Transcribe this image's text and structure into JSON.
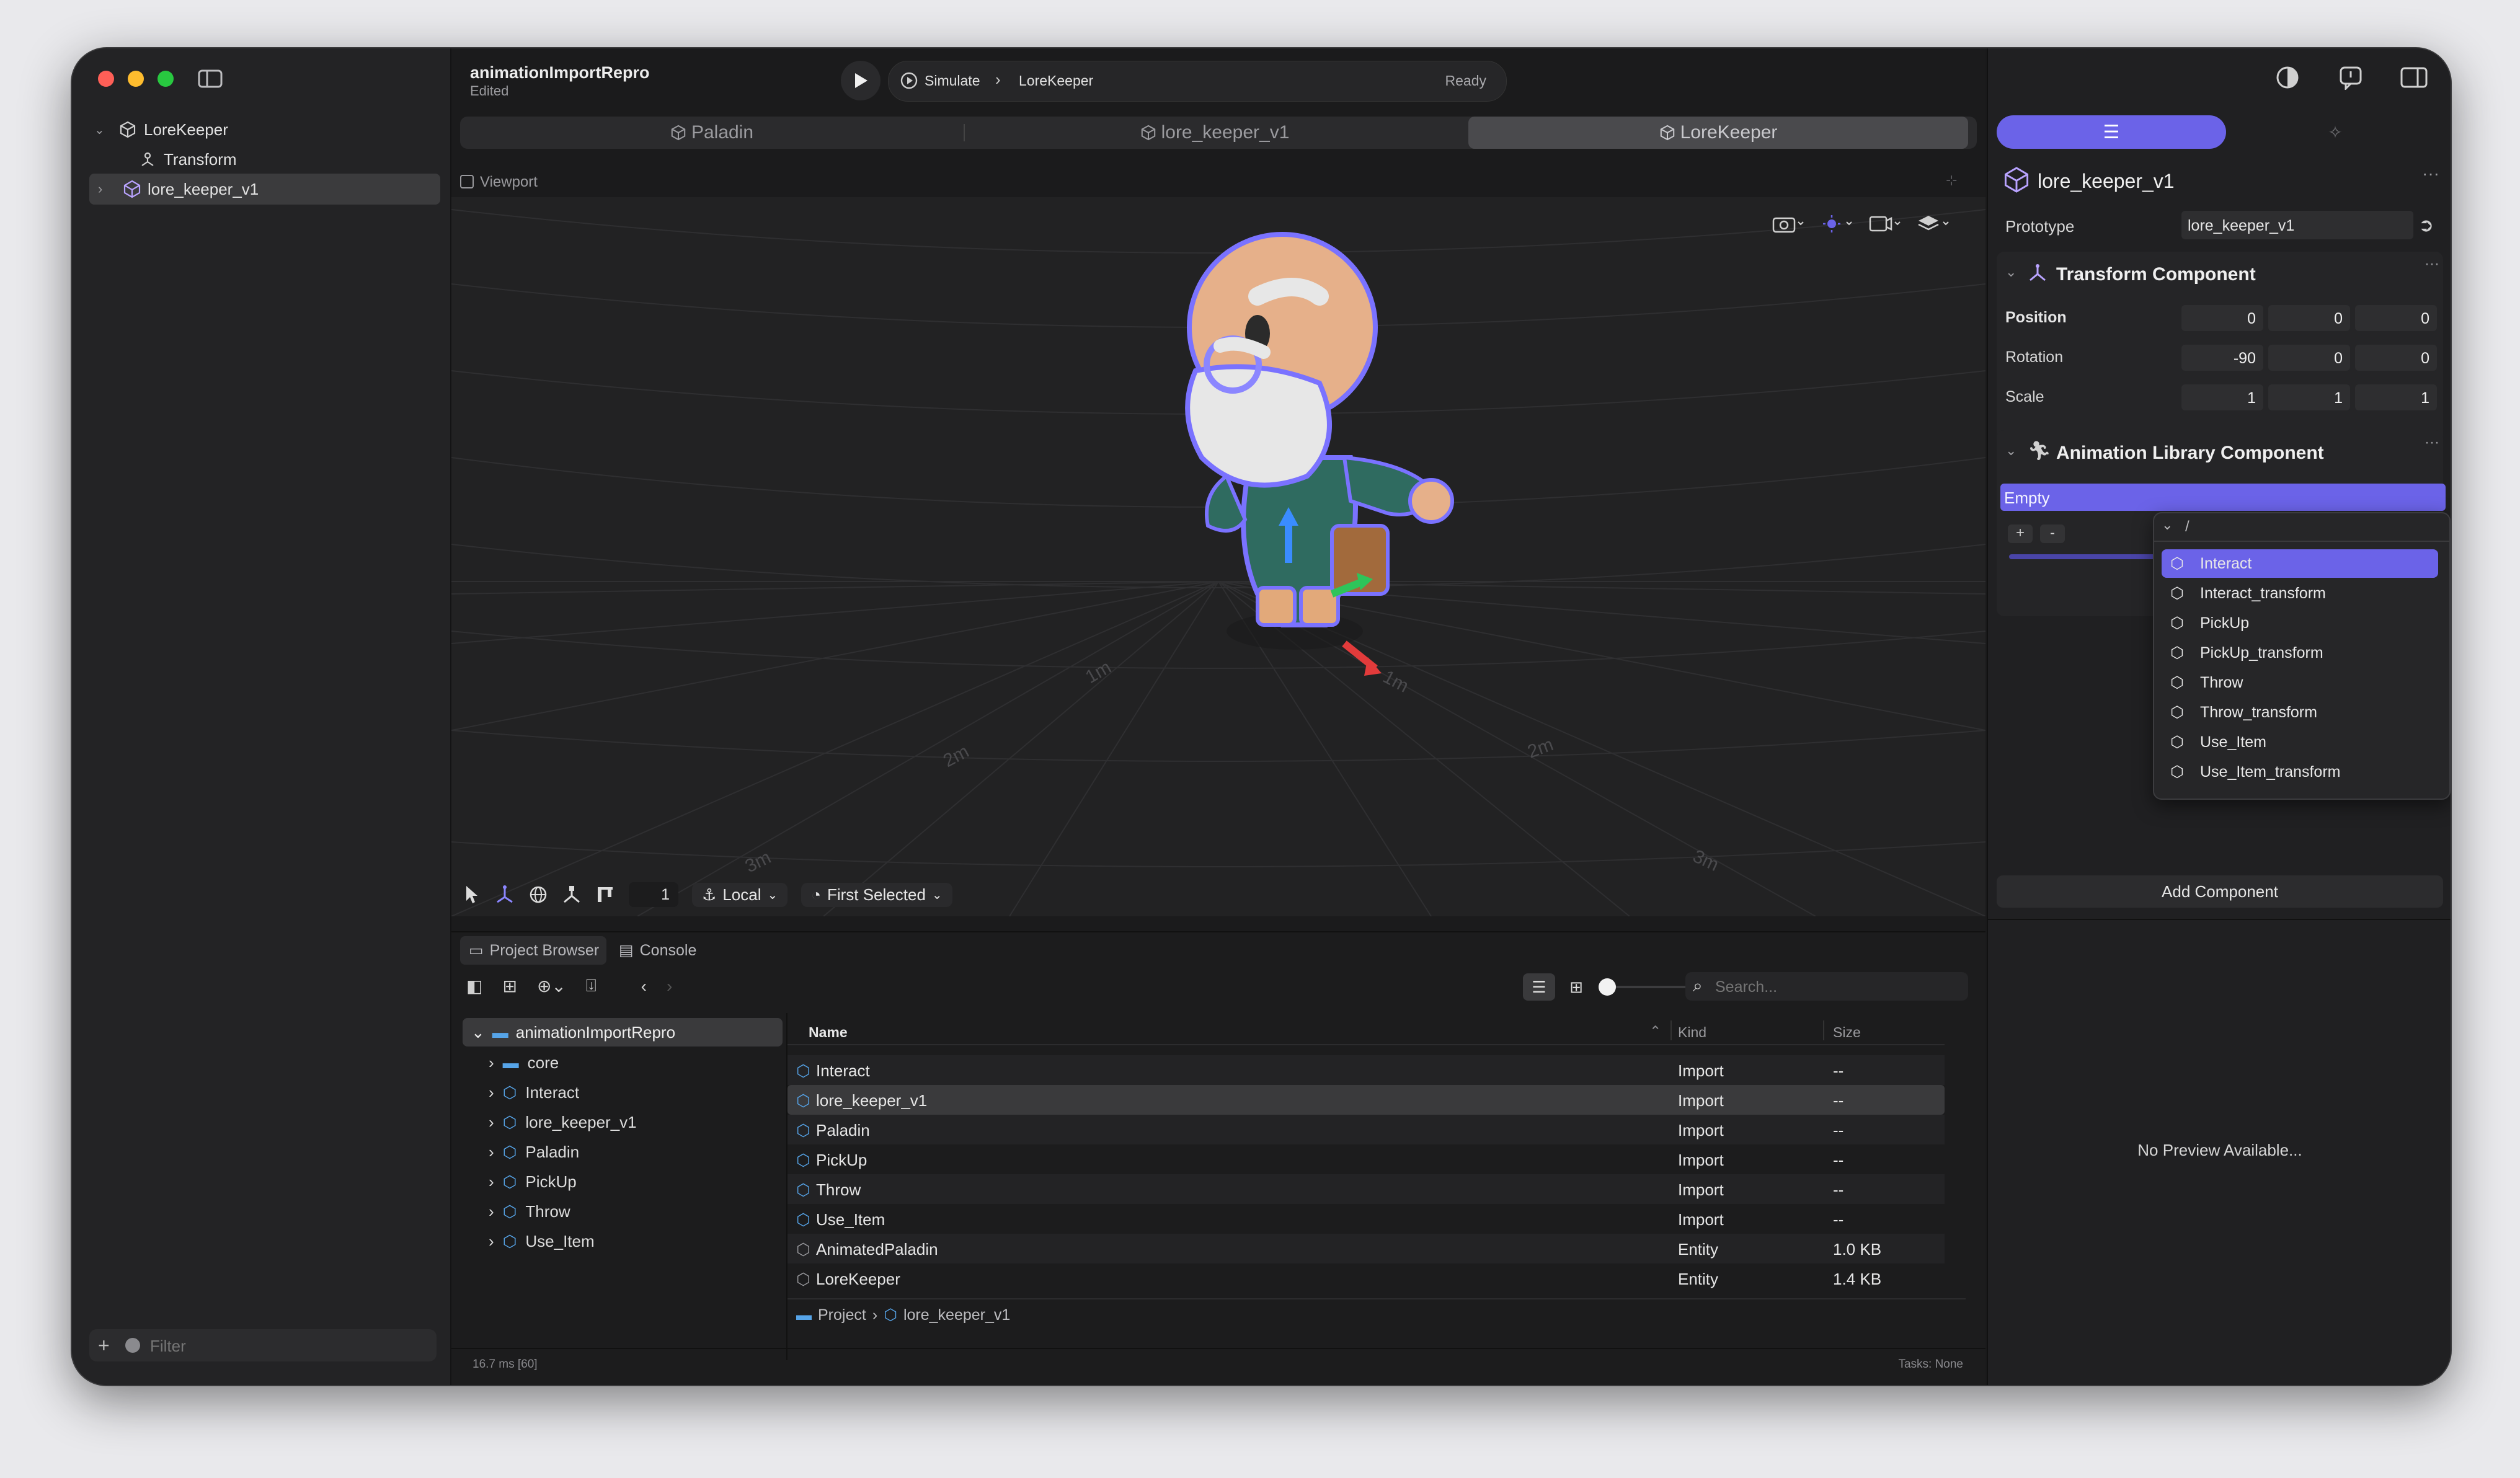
{
  "project": {
    "title": "animationImportRepro",
    "subtitle": "Edited"
  },
  "toolbar": {
    "simulate_label": "Simulate",
    "target_label": "LoreKeeper",
    "status": "Ready"
  },
  "tabs": [
    {
      "label": "Paladin",
      "active": false
    },
    {
      "label": "lore_keeper_v1",
      "active": false
    },
    {
      "label": "LoreKeeper",
      "active": true
    }
  ],
  "sidebar": {
    "tree": [
      {
        "label": "LoreKeeper",
        "icon": "cube-icon",
        "expanded": true
      },
      {
        "label": "Transform",
        "icon": "transform-icon"
      },
      {
        "label": "lore_keeper_v1",
        "icon": "entity-icon",
        "selected": true
      }
    ],
    "filter_placeholder": "Filter"
  },
  "viewport": {
    "label": "Viewport",
    "grid_labels": [
      "1m",
      "2m",
      "3m",
      "1m",
      "2m",
      "3m"
    ],
    "bottom_toolbar": {
      "snap_value": "1",
      "space": "Local",
      "pivot": "First Selected"
    }
  },
  "bottom_panel": {
    "tabs": [
      "Project Browser",
      "Console"
    ],
    "search_placeholder": "Search...",
    "folder_tree": [
      {
        "label": "animationImportRepro",
        "kind": "folder",
        "expanded": true
      },
      {
        "label": "core",
        "kind": "folder"
      },
      {
        "label": "Interact",
        "kind": "import"
      },
      {
        "label": "lore_keeper_v1",
        "kind": "import"
      },
      {
        "label": "Paladin",
        "kind": "import"
      },
      {
        "label": "PickUp",
        "kind": "import"
      },
      {
        "label": "Throw",
        "kind": "import"
      },
      {
        "label": "Use_Item",
        "kind": "import"
      }
    ],
    "columns": [
      "Name",
      "Kind",
      "Size"
    ],
    "rows": [
      {
        "name": "Interact",
        "kind": "Import",
        "size": "--"
      },
      {
        "name": "lore_keeper_v1",
        "kind": "Import",
        "size": "--"
      },
      {
        "name": "Paladin",
        "kind": "Import",
        "size": "--"
      },
      {
        "name": "PickUp",
        "kind": "Import",
        "size": "--"
      },
      {
        "name": "Throw",
        "kind": "Import",
        "size": "--"
      },
      {
        "name": "Use_Item",
        "kind": "Import",
        "size": "--"
      },
      {
        "name": "AnimatedPaladin",
        "kind": "Entity",
        "size": "1.0 KB"
      },
      {
        "name": "LoreKeeper",
        "kind": "Entity",
        "size": "1.4 KB"
      }
    ],
    "breadcrumb": [
      "Project",
      "lore_keeper_v1"
    ],
    "frame_time": "16.7 ms [60]",
    "tasks": "Tasks: None"
  },
  "inspector": {
    "entity_name": "lore_keeper_v1",
    "prototype_label": "Prototype",
    "prototype_value": "lore_keeper_v1",
    "transform": {
      "title": "Transform Component",
      "position_label": "Position",
      "position": [
        "0",
        "0",
        "0"
      ],
      "rotation_label": "Rotation",
      "rotation": [
        "-90",
        "0",
        "0"
      ],
      "scale_label": "Scale",
      "scale": [
        "1",
        "1",
        "1"
      ]
    },
    "anim_library": {
      "title": "Animation Library Component",
      "empty_label": "Empty",
      "add": "+",
      "remove": "-"
    },
    "dropdown": {
      "path": "/",
      "items": [
        {
          "label": "Interact",
          "highlighted": true
        },
        {
          "label": "Interact_transform"
        },
        {
          "label": "PickUp"
        },
        {
          "label": "PickUp_transform"
        },
        {
          "label": "Throw"
        },
        {
          "label": "Throw_transform"
        },
        {
          "label": "Use_Item"
        },
        {
          "label": "Use_Item_transform"
        }
      ]
    },
    "add_component_label": "Add Component",
    "no_preview": "No Preview Available...",
    "more": "···"
  },
  "colors": {
    "accent": "#6b63e8",
    "traffic_red": "#fe5f57",
    "traffic_yellow": "#febc2e",
    "traffic_green": "#28c840"
  }
}
